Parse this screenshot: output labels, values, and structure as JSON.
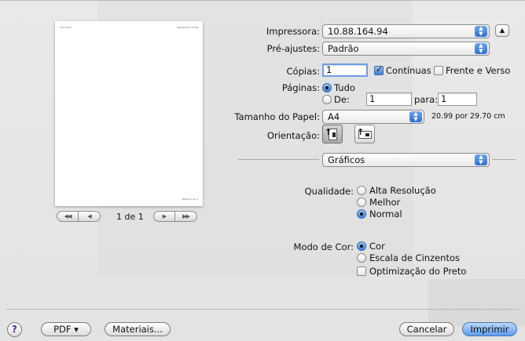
{
  "preview": {
    "header_left": "Sem título",
    "header_right": "26/04/2013 17:08",
    "footer": "Página 1 de 1",
    "page_count": "1 de 1",
    "first_label": "◀◀",
    "prev_label": "◀",
    "next_label": "▶",
    "last_label": "▶▶"
  },
  "printer": {
    "label": "Impressora:",
    "value": "10.88.164.94",
    "disclosure_icon": "triangle-up-icon"
  },
  "presets": {
    "label": "Pré-ajustes:",
    "value": "Padrão"
  },
  "copies": {
    "label": "Cópias:",
    "value": "1",
    "collated_label": "Contínuas",
    "collated_checked": true,
    "duplex_label": "Frente e Verso",
    "duplex_checked": false
  },
  "pages": {
    "label": "Páginas:",
    "all_label": "Tudo",
    "all_selected": true,
    "from_label": "De:",
    "from_value": "1",
    "to_label": "para:",
    "to_value": "1"
  },
  "paper_size": {
    "label": "Tamanho do Papel:",
    "value": "A4",
    "dimensions": "20.99 por 29.70 cm"
  },
  "orientation": {
    "label": "Orientação:",
    "selected": "portrait"
  },
  "panel": {
    "value": "Gráficos"
  },
  "quality": {
    "label": "Qualidade:",
    "options": [
      "Alta Resolução",
      "Melhor",
      "Normal"
    ],
    "selected": "Normal"
  },
  "color_mode": {
    "label": "Modo de Cor:",
    "options": [
      "Cor",
      "Escala de Cinzentos"
    ],
    "selected": "Cor",
    "black_opt_label": "Optimização do Preto",
    "black_opt_checked": false
  },
  "footer": {
    "help": "?",
    "pdf": "PDF ▾",
    "materials": "Materiais...",
    "cancel": "Cancelar",
    "print": "Imprimir"
  }
}
